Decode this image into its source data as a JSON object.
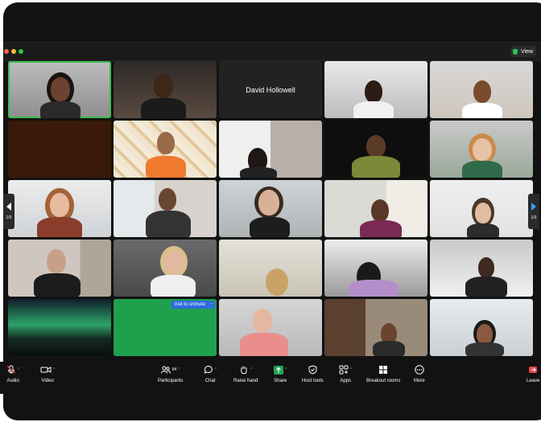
{
  "window": {
    "view_label": "View"
  },
  "grid": {
    "named_tile": "David Hollowell",
    "ask_to_unmute": "Ask to unmute",
    "more": "···"
  },
  "navigation": {
    "left_page": "1/3",
    "right_page": "1/3"
  },
  "toolbar": {
    "audio": "Audio",
    "video": "Video",
    "participants": "Participants",
    "participants_count": "84",
    "chat": "Chat",
    "raise_hand": "Raise hand",
    "share": "Share",
    "host_tools": "Host tools",
    "apps": "Apps",
    "breakout_rooms": "Breakout rooms",
    "more": "More",
    "leave": "Leave"
  },
  "colors": {
    "accent_green": "#3fbf4f",
    "mute_red": "#e5484d",
    "share_green": "#23a559",
    "unmute_blue": "#2d6cdf"
  }
}
